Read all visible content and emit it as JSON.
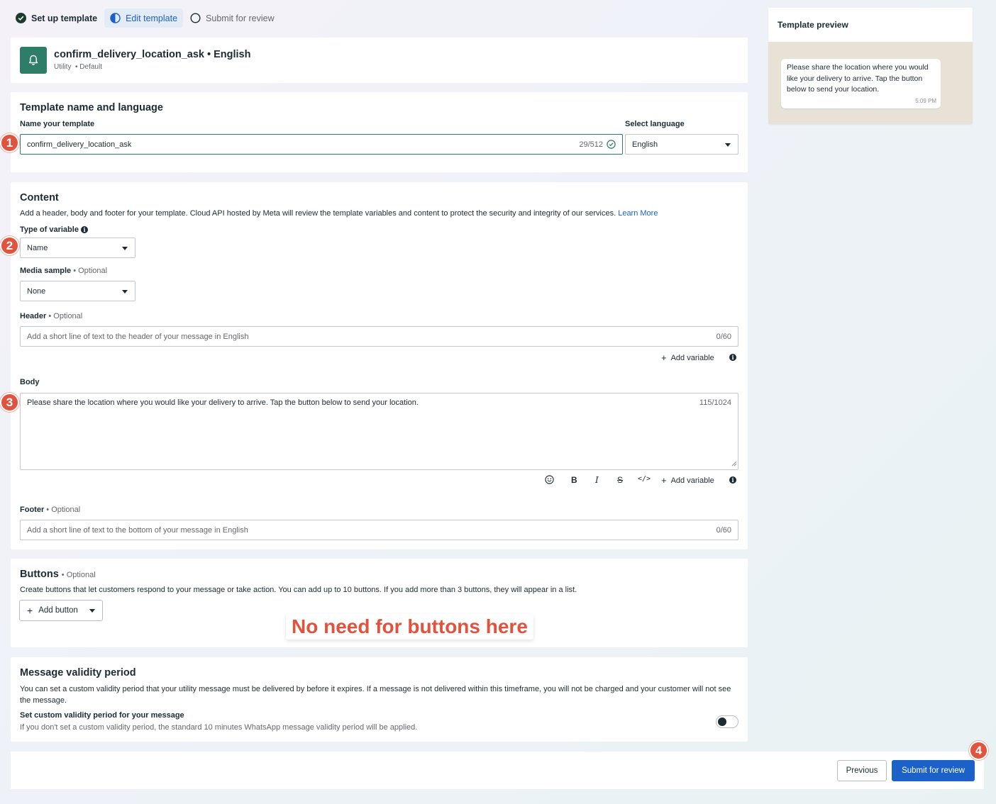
{
  "stepper": {
    "steps": [
      {
        "label": "Set up template",
        "state": "done"
      },
      {
        "label": "Edit template",
        "state": "active"
      },
      {
        "label": "Submit for review",
        "state": "pending"
      }
    ]
  },
  "header": {
    "title": "confirm_delivery_location_ask • English",
    "category": "Utility",
    "type": "• Default"
  },
  "name_section": {
    "title": "Template name and language",
    "name_label": "Name your template",
    "name_value": "confirm_delivery_location_ask",
    "name_counter": "29/512",
    "language_label": "Select language",
    "language_value": "English"
  },
  "content": {
    "title": "Content",
    "description": "Add a header, body and footer for your template. Cloud API hosted by Meta will review the template variables and content to protect the security and integrity of our services.",
    "learn_more": "Learn More",
    "variable_type_label": "Type of variable",
    "variable_type_value": "Name",
    "media_label": "Media sample",
    "optional": "• Optional",
    "media_value": "None",
    "header_label": "Header",
    "header_placeholder": "Add a short line of text to the header of your message in English",
    "header_counter": "0/60",
    "add_variable": "Add variable",
    "body_label": "Body",
    "body_value": "Please share the location where you would like your delivery to arrive. Tap the button below to send your location.",
    "body_counter": "115/1024",
    "footer_label": "Footer",
    "footer_placeholder": "Add a short line of text to the bottom of your message in English",
    "footer_counter": "0/60"
  },
  "buttons_section": {
    "title": "Buttons",
    "optional": "• Optional",
    "description": "Create buttons that let customers respond to your message or take action. You can add up to 10 buttons. If you add more than 3 buttons, they will appear in a list.",
    "add_button": "Add button"
  },
  "annotation": "No need for buttons here",
  "validity": {
    "title": "Message validity period",
    "description": "You can set a custom validity period that your utility message must be delivered by before it expires. If a message is not delivered within this timeframe, you will not be charged and your customer will not see the message.",
    "toggle_label": "Set custom validity period for your message",
    "toggle_help": "If you don't set a custom validity period, the standard 10 minutes WhatsApp message validity period will be applied.",
    "toggle_on": false
  },
  "preview": {
    "title": "Template preview",
    "message": "Please share the location where you would like your delivery to arrive. Tap the button below to send your location.",
    "time": "5:09 PM"
  },
  "actions": {
    "previous": "Previous",
    "submit": "Submit for review"
  },
  "markers": [
    "1",
    "2",
    "3",
    "4"
  ],
  "colors": {
    "primary": "#1b61c7",
    "brand_green": "#2e7d68",
    "marker": "#e0533f"
  }
}
